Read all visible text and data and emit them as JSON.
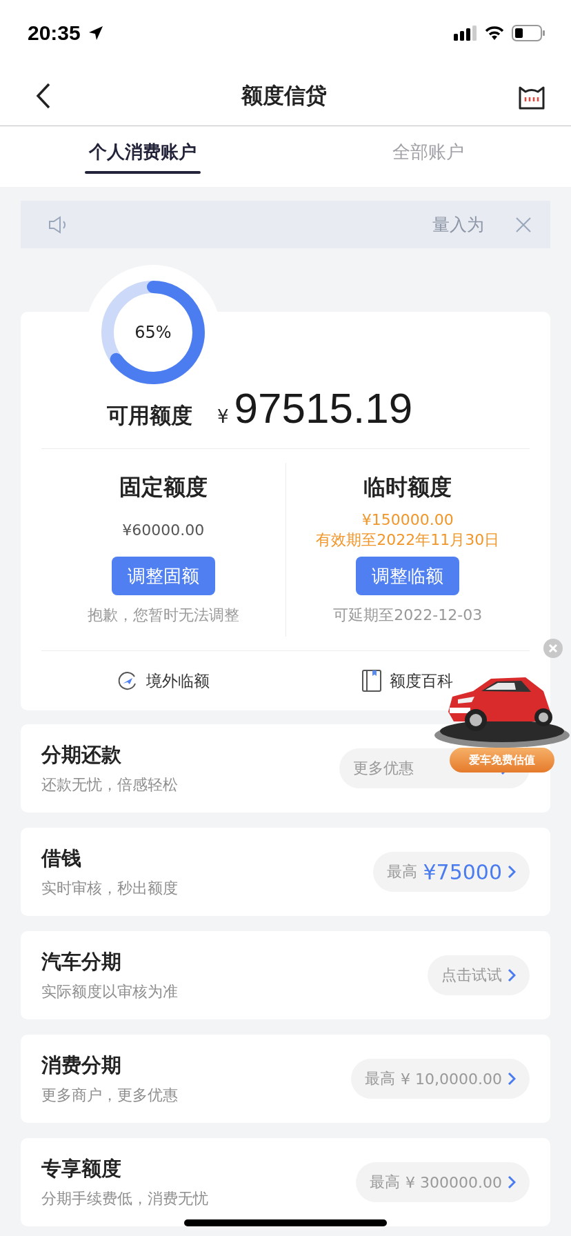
{
  "status_bar": {
    "time": "20:35"
  },
  "nav": {
    "title": "额度信贷"
  },
  "tabs": [
    {
      "label": "个人消费账户",
      "selected": true
    },
    {
      "label": "全部账户",
      "selected": false
    }
  ],
  "notice": {
    "text": "量入为"
  },
  "credit": {
    "ring": {
      "percent": "65%"
    },
    "label": "可用额度",
    "currency": "¥",
    "amount": "97515.19",
    "fixed": {
      "title": "固定额度",
      "lines": [
        "¥60000.00"
      ],
      "highlight": false,
      "button": "调整固额",
      "note": "抱歉，您暂时无法调整"
    },
    "temporary": {
      "title": "临时额度",
      "lines": [
        "¥150000.00",
        "有效期至2022年11月30日"
      ],
      "highlight": true,
      "button": "调整临额",
      "note": "可延期至2022-12-03"
    },
    "links": [
      {
        "kind": "plane",
        "label": "境外临额"
      },
      {
        "kind": "book",
        "label": "额度百科"
      }
    ]
  },
  "products": [
    {
      "title": "分期还款",
      "subtitle": "还款无忧，倍感轻松",
      "action": {
        "kind": "promo",
        "label": "更多优惠"
      }
    },
    {
      "title": "借钱",
      "subtitle": "实时审核，秒出额度",
      "action": {
        "label": "最高",
        "value": "¥75000",
        "highlight": true
      }
    },
    {
      "title": "汽车分期",
      "subtitle": "实际额度以审核为准",
      "action": {
        "label": "点击试试"
      }
    },
    {
      "title": "消费分期",
      "subtitle": "更多商户，更多优惠",
      "action": {
        "label": "最高",
        "value": "¥ 10,0000.00",
        "highlight": false
      }
    },
    {
      "title": "专享额度",
      "subtitle": "分期手续费低，消费无忧",
      "action": {
        "label": "最高",
        "value": "¥ 300000.00",
        "highlight": false
      }
    }
  ],
  "promo": {
    "label": "爱车免费估值"
  }
}
